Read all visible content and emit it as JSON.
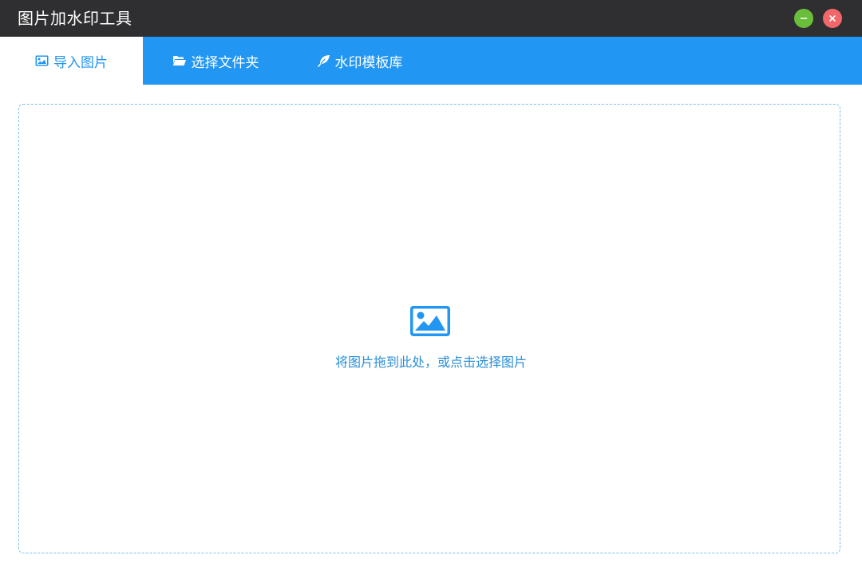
{
  "window": {
    "title": "图片加水印工具"
  },
  "tabs": [
    {
      "label": "导入图片",
      "icon": "image-icon",
      "active": true
    },
    {
      "label": "选择文件夹",
      "icon": "folder-open-icon",
      "active": false
    },
    {
      "label": "水印模板库",
      "icon": "feather-icon",
      "active": false
    }
  ],
  "dropzone": {
    "icon": "image-icon",
    "hint": "将图片拖到此处，或点击选择图片"
  },
  "colors": {
    "titlebar_bg": "#2f2f31",
    "accent": "#2196f3",
    "minimize_button": "#6abf3a",
    "close_button": "#f2676a",
    "dropzone_border": "#7cc0e8",
    "hint_text": "#2b8fd6"
  }
}
